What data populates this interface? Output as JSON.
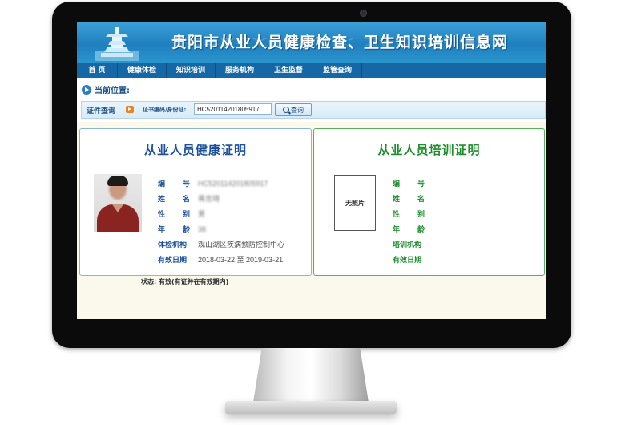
{
  "site": {
    "title": "贵阳市从业人员健康检查、卫生知识培训信息网"
  },
  "nav": [
    "首  页",
    "健康体检",
    "知识培训",
    "服务机构",
    "卫生监督",
    "监管查询"
  ],
  "breadcrumb": {
    "label": "当前位置:"
  },
  "search": {
    "section_title": "证件查询",
    "field_label": "证书编码/身份证:",
    "value": "HC520114201805917",
    "button_label": "查询"
  },
  "health_card": {
    "title": "从业人员健康证明",
    "fields": [
      {
        "label": "编号",
        "value": "HC520114201805917"
      },
      {
        "label": "姓名",
        "value": "蒋忠琦"
      },
      {
        "label": "性别",
        "value": "男"
      },
      {
        "label": "年龄",
        "value": "38"
      },
      {
        "label": "体检机构",
        "value": "观山湖区疾病预防控制中心"
      },
      {
        "label": "有效日期",
        "value": "2018-03-22 至 2019-03-21"
      }
    ]
  },
  "training_card": {
    "title": "从业人员培训证明",
    "no_photo_label": "无照片",
    "fields": [
      {
        "label": "编号",
        "value": ""
      },
      {
        "label": "姓名",
        "value": ""
      },
      {
        "label": "性别",
        "value": ""
      },
      {
        "label": "年龄",
        "value": ""
      },
      {
        "label": "培训机构",
        "value": ""
      },
      {
        "label": "有效日期",
        "value": ""
      }
    ]
  },
  "status": {
    "text": "状态: 有效(有证并在有效期内)"
  },
  "colors": {
    "banner": "#1f7fbf",
    "nav": "#1667a6",
    "health_accent": "#1c4f9c",
    "training_accent": "#1e8e2e"
  }
}
